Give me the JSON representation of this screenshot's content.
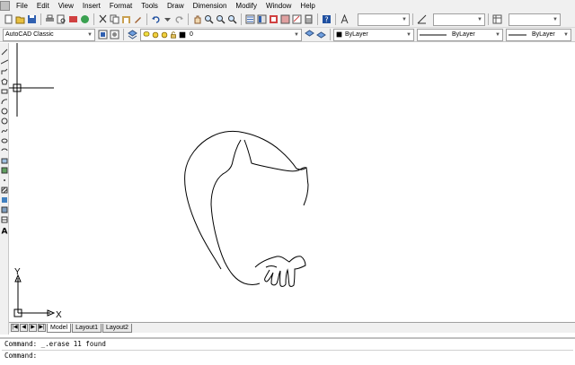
{
  "menubar": {
    "items": [
      "File",
      "Edit",
      "View",
      "Insert",
      "Format",
      "Tools",
      "Draw",
      "Dimension",
      "Modify",
      "Window",
      "Help"
    ]
  },
  "toolbar2": {
    "workspace": "AutoCAD Classic",
    "layer_name": "0",
    "color": "ByLayer",
    "linetype": "ByLayer",
    "lineweight": "ByLayer"
  },
  "tabs": {
    "items": [
      "Model",
      "Layout1",
      "Layout2"
    ],
    "active": "Model"
  },
  "ucs": {
    "x_label": "X",
    "y_label": "Y"
  },
  "command": {
    "history": "Command: _.erase 11 found",
    "prompt": "Command:"
  },
  "colors": {
    "ui_background": "#f0f0f0",
    "canvas_background": "#ffffff",
    "drawing_stroke": "#000000"
  }
}
